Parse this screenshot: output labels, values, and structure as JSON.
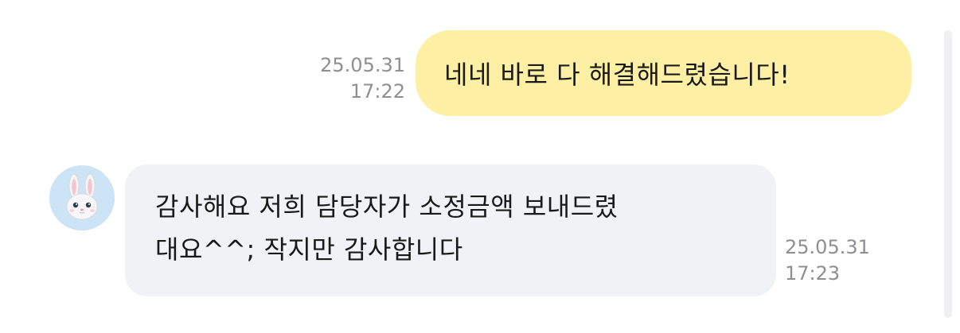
{
  "messages": [
    {
      "direction": "outgoing",
      "text": "네네 바로 다 해결해드렸습니다!",
      "date": "25.05.31",
      "time": "17:22",
      "bubble_color": "#fdf0a5"
    },
    {
      "direction": "incoming",
      "lines": [
        "감사해요 저희 담당자가 소정금액 보내드렸",
        "대요^^; 작지만 감사합니다"
      ],
      "date": "25.05.31",
      "time": "17:23",
      "bubble_color": "#f1f2f6",
      "avatar_icon": "rabbit-icon"
    }
  ],
  "colors": {
    "timestamp": "#8e8e93",
    "avatar_bg": "#cde3f6"
  }
}
